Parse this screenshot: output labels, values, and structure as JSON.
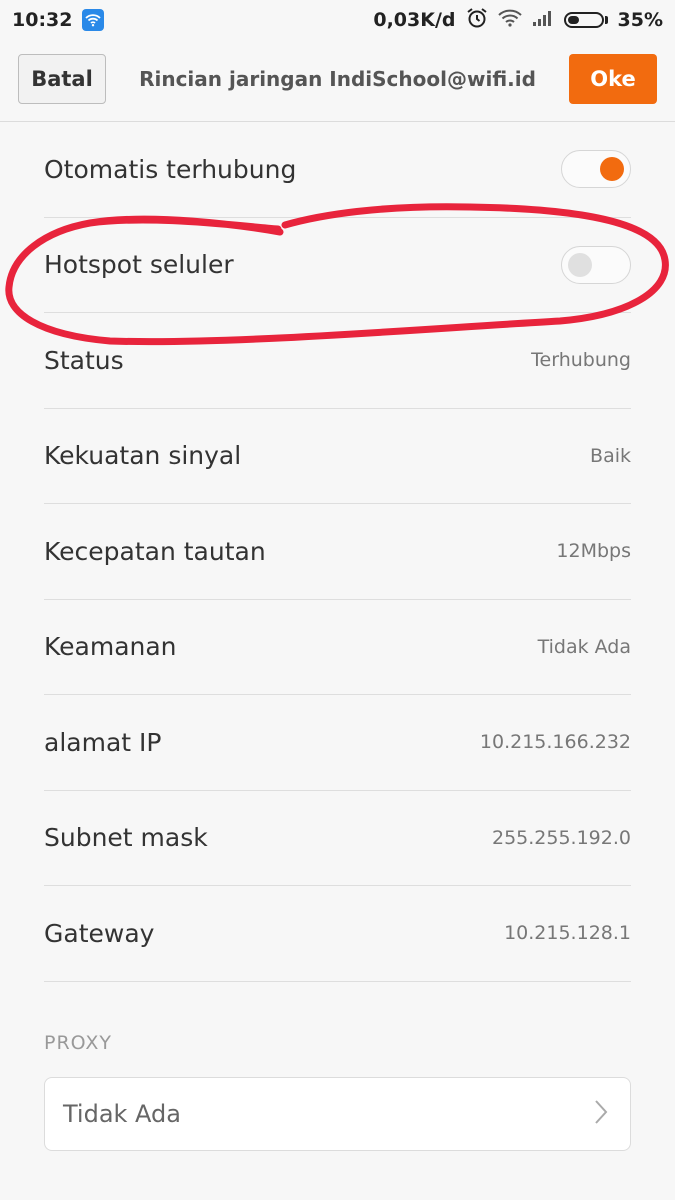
{
  "status_bar": {
    "time": "10:32",
    "speed": "0,03K/d",
    "battery": "35%",
    "battery_level": 0.35,
    "icons": [
      "wifi-notification-icon",
      "alarm-icon",
      "wifi-signal-icon",
      "cell-signal-icon",
      "battery-icon"
    ]
  },
  "header": {
    "cancel_label": "Batal",
    "title": "Rincian jaringan IndiSchool@wifi.id",
    "ok_label": "Oke"
  },
  "settings": [
    {
      "label": "Otomatis terhubung",
      "type": "toggle",
      "on": true
    },
    {
      "label": "Hotspot seluler",
      "type": "toggle",
      "on": false
    },
    {
      "label": "Status",
      "value": "Terhubung"
    },
    {
      "label": "Kekuatan sinyal",
      "value": "Baik"
    },
    {
      "label": "Kecepatan tautan",
      "value": "12Mbps"
    },
    {
      "label": "Keamanan",
      "value": "Tidak Ada"
    },
    {
      "label": "alamat IP",
      "value": "10.215.166.232"
    },
    {
      "label": "Subnet mask",
      "value": "255.255.192.0"
    },
    {
      "label": "Gateway",
      "value": "10.215.128.1"
    }
  ],
  "proxy": {
    "header": "PROXY",
    "value": "Tidak Ada"
  },
  "colors": {
    "accent": "#f26b0f",
    "annotation": "#e8243c",
    "background": "#f7f7f7"
  }
}
